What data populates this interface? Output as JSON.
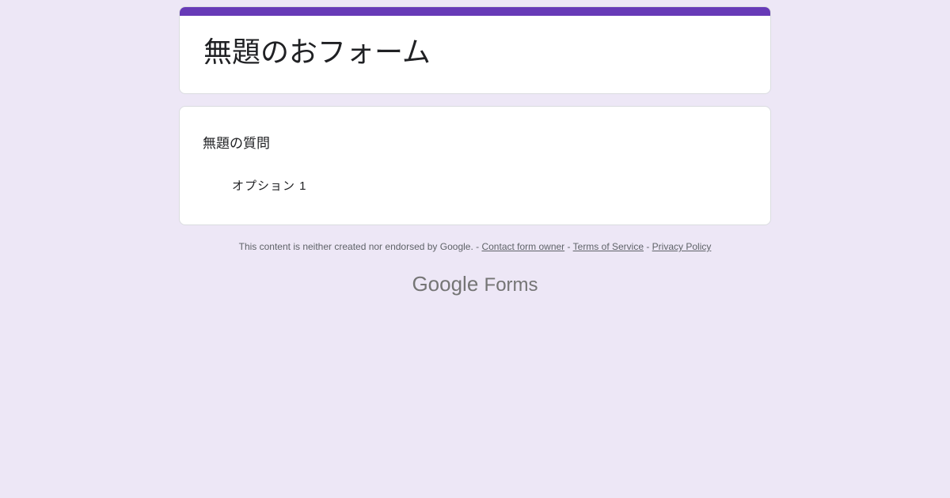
{
  "form": {
    "title": "無題のおフォーム",
    "accent_color": "#673ab7"
  },
  "question": {
    "title": "無題の質問",
    "options": [
      "オプション 1"
    ]
  },
  "footer": {
    "disclaimer": "This content is neither created nor endorsed by Google. - ",
    "contact": "Contact form owner",
    "sep": " - ",
    "terms": "Terms of Service",
    "privacy": "Privacy Policy"
  },
  "brand": {
    "google": "Google",
    "forms": "Forms"
  }
}
